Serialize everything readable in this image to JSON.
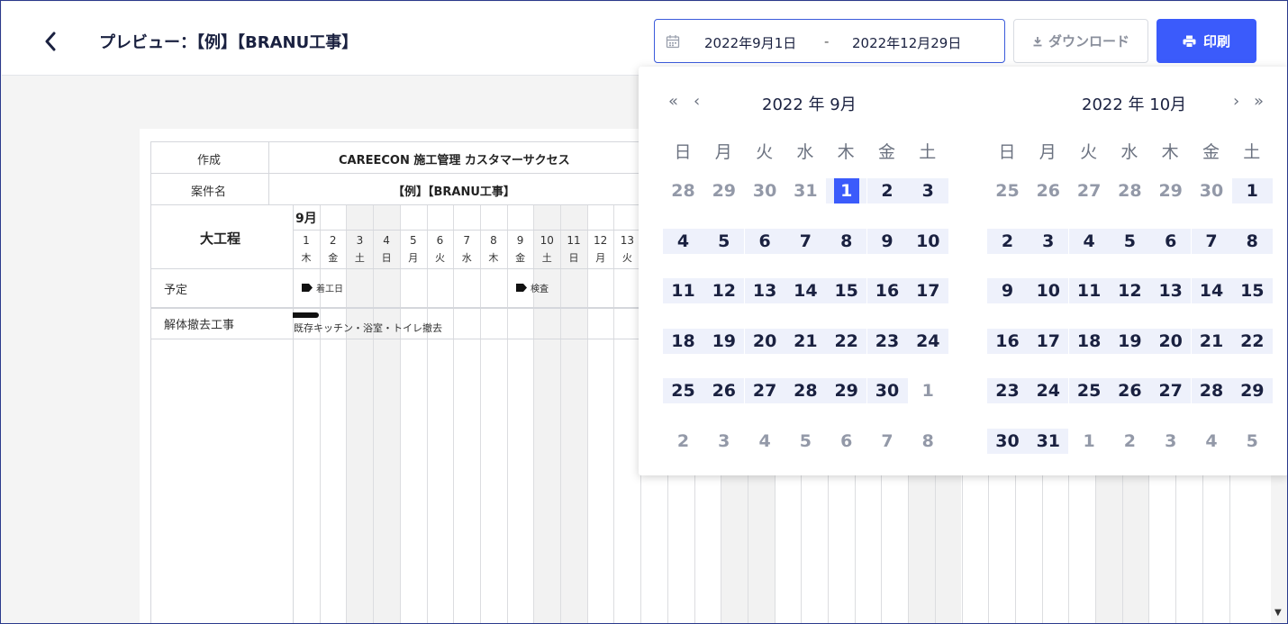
{
  "header": {
    "title": "プレビュー：【例】【BRANU工事】",
    "range_start": "2022年9月1日",
    "range_sep": "-",
    "range_end": "2022年12月29日",
    "download_label": "ダウンロード",
    "print_label": "印刷"
  },
  "sheet": {
    "author_label": "作成",
    "author_value": "CAREECON 施工管理 カスタマーサクセス",
    "project_label": "案件名",
    "project_value": "【例】【BRANU工事】",
    "process_header": "大工程",
    "month_label": "9月",
    "days": [
      {
        "d": "1",
        "w": "木"
      },
      {
        "d": "2",
        "w": "金"
      },
      {
        "d": "3",
        "w": "土"
      },
      {
        "d": "4",
        "w": "日"
      },
      {
        "d": "5",
        "w": "月"
      },
      {
        "d": "6",
        "w": "火"
      },
      {
        "d": "7",
        "w": "水"
      },
      {
        "d": "8",
        "w": "木"
      },
      {
        "d": "9",
        "w": "金"
      },
      {
        "d": "10",
        "w": "土"
      },
      {
        "d": "11",
        "w": "日"
      },
      {
        "d": "12",
        "w": "月"
      },
      {
        "d": "13",
        "w": "火"
      }
    ],
    "rows": [
      {
        "label": "予定",
        "events": [
          {
            "text": "着工日"
          },
          {
            "text": "検査"
          }
        ]
      },
      {
        "label": "解体撤去工事",
        "bar_text": "既存キッチン・浴室・トイレ撤去"
      }
    ]
  },
  "calendar": {
    "left_title": "2022 年 9月",
    "right_title": "2022 年 10月",
    "dow": [
      "日",
      "月",
      "火",
      "水",
      "木",
      "金",
      "土"
    ],
    "nav_prev_year": "«",
    "nav_prev_month": "‹",
    "nav_next_month": "›",
    "nav_next_year": "»",
    "left_weeks": [
      [
        "28",
        "29",
        "30",
        "31",
        "1",
        "2",
        "3"
      ],
      [
        "4",
        "5",
        "6",
        "7",
        "8",
        "9",
        "10"
      ],
      [
        "11",
        "12",
        "13",
        "14",
        "15",
        "16",
        "17"
      ],
      [
        "18",
        "19",
        "20",
        "21",
        "22",
        "23",
        "24"
      ],
      [
        "25",
        "26",
        "27",
        "28",
        "29",
        "30",
        "1"
      ],
      [
        "2",
        "3",
        "4",
        "5",
        "6",
        "7",
        "8"
      ]
    ],
    "right_weeks": [
      [
        "25",
        "26",
        "27",
        "28",
        "29",
        "30",
        "1"
      ],
      [
        "2",
        "3",
        "4",
        "5",
        "6",
        "7",
        "8"
      ],
      [
        "9",
        "10",
        "11",
        "12",
        "13",
        "14",
        "15"
      ],
      [
        "16",
        "17",
        "18",
        "19",
        "20",
        "21",
        "22"
      ],
      [
        "23",
        "24",
        "25",
        "26",
        "27",
        "28",
        "29"
      ],
      [
        "30",
        "31",
        "1",
        "2",
        "3",
        "4",
        "5"
      ]
    ],
    "selected_day": "1",
    "accent_color": "#3b5bfb",
    "range_bg_color": "#eef1fb"
  },
  "icons": {
    "back": "chevron-left-icon",
    "calendar": "calendar-icon",
    "download": "download-icon",
    "print": "printer-icon"
  }
}
